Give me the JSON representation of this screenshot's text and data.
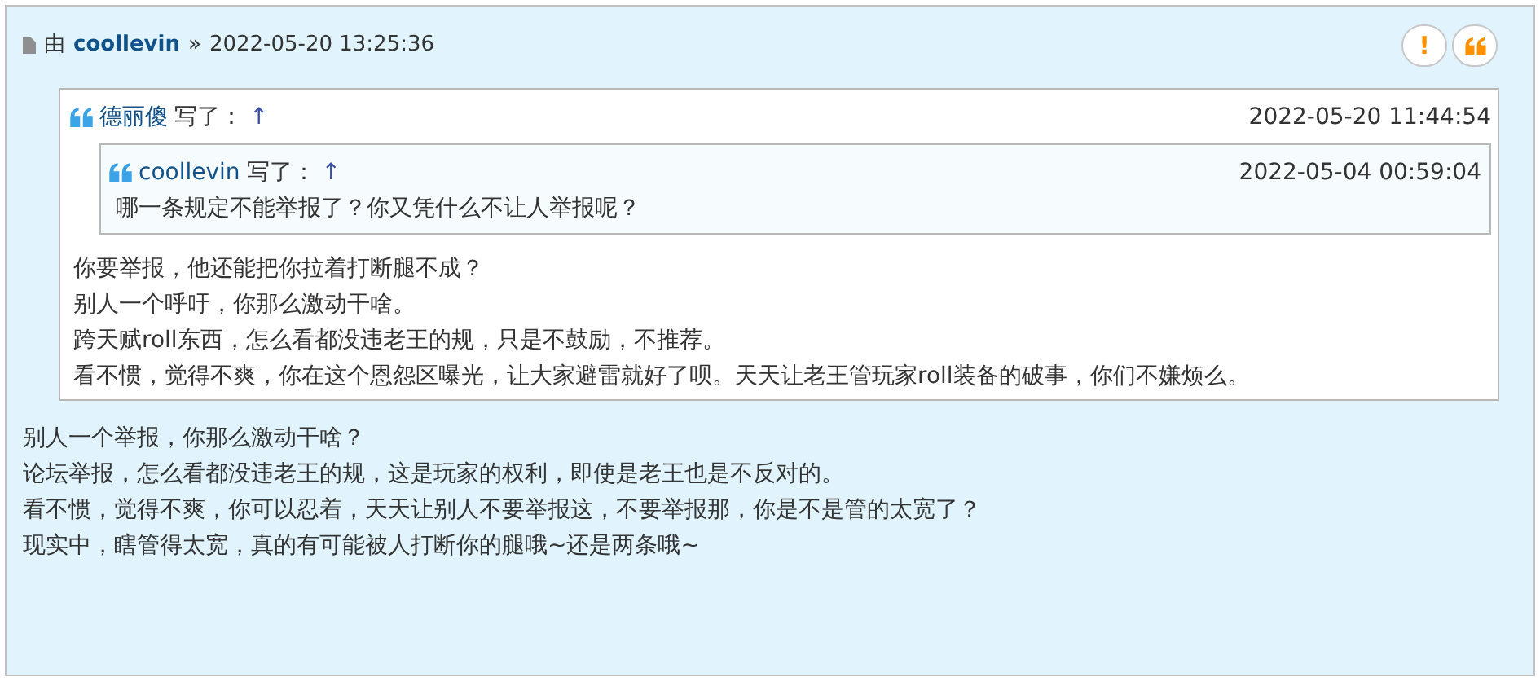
{
  "post": {
    "author_prefix": "由",
    "author": "coollevin",
    "separator": "»",
    "time": "2022-05-20 13:25:36",
    "report_button": "!",
    "quote": {
      "author": "德丽傻",
      "wrote": "写了：",
      "jump": "↑",
      "time": "2022-05-20 11:44:54",
      "quote": {
        "author": "coollevin",
        "wrote": "写了：",
        "jump": "↑",
        "time": "2022-05-04 00:59:04",
        "lines": [
          "哪一条规定不能举报了？你又凭什么不让人举报呢？"
        ]
      },
      "lines": [
        "你要举报，他还能把你拉着打断腿不成？",
        "别人一个呼吁，你那么激动干啥。",
        "跨天赋roll东西，怎么看都没违老王的规，只是不鼓励，不推荐。",
        "看不惯，觉得不爽，你在这个恩怨区曝光，让大家避雷就好了呗。天天让老王管玩家roll装备的破事，你们不嫌烦么。"
      ]
    },
    "lines": [
      "别人一个举报，你那么激动干啥？",
      "论坛举报，怎么看都没违老王的规，这是玩家的权利，即使是老王也是不反对的。",
      "看不惯，觉得不爽，你可以忍着，天天让别人不要举报这，不要举报那，你是不是管的太宽了？",
      "现实中，瞎管得太宽，真的有可能被人打断你的腿哦~还是两条哦~"
    ]
  }
}
